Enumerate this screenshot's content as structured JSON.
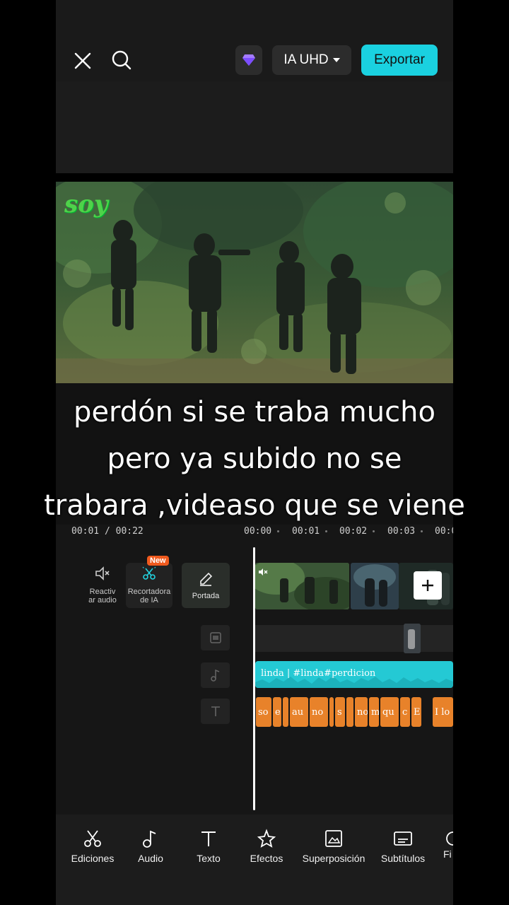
{
  "topbar": {
    "premium_label": "IA UHD",
    "export_label": "Exportar",
    "export_color": "#1ad1e0"
  },
  "video": {
    "overlay_text": "soy"
  },
  "caption": {
    "lines": [
      "perdón si se traba mucho",
      "pero ya subido no se",
      "trabara ,videaso que se viene"
    ]
  },
  "timeline": {
    "current_time": "00:01 / 00:22",
    "ruler": [
      "00:00",
      "00:01",
      "00:02",
      "00:03",
      "00:0"
    ],
    "tools": [
      {
        "label": "Reactiv\nar audio",
        "icon": "speaker-mute-icon"
      },
      {
        "label": "Recortadora\nde IA",
        "icon": "ai-cutter-icon",
        "badge": "New"
      },
      {
        "label": "Portada",
        "icon": "pencil-icon"
      }
    ],
    "audio_clip_label": "linda | #linda#perdicion",
    "text_clips": [
      "so",
      "e",
      "",
      "au",
      "no",
      "",
      "s",
      "",
      "no",
      "m",
      "qu",
      "c",
      "E",
      "I lo"
    ]
  },
  "bottom_toolbar": {
    "items": [
      "Ediciones",
      "Audio",
      "Texto",
      "Efectos",
      "Superposición",
      "Subtítulos",
      "Fi"
    ]
  }
}
